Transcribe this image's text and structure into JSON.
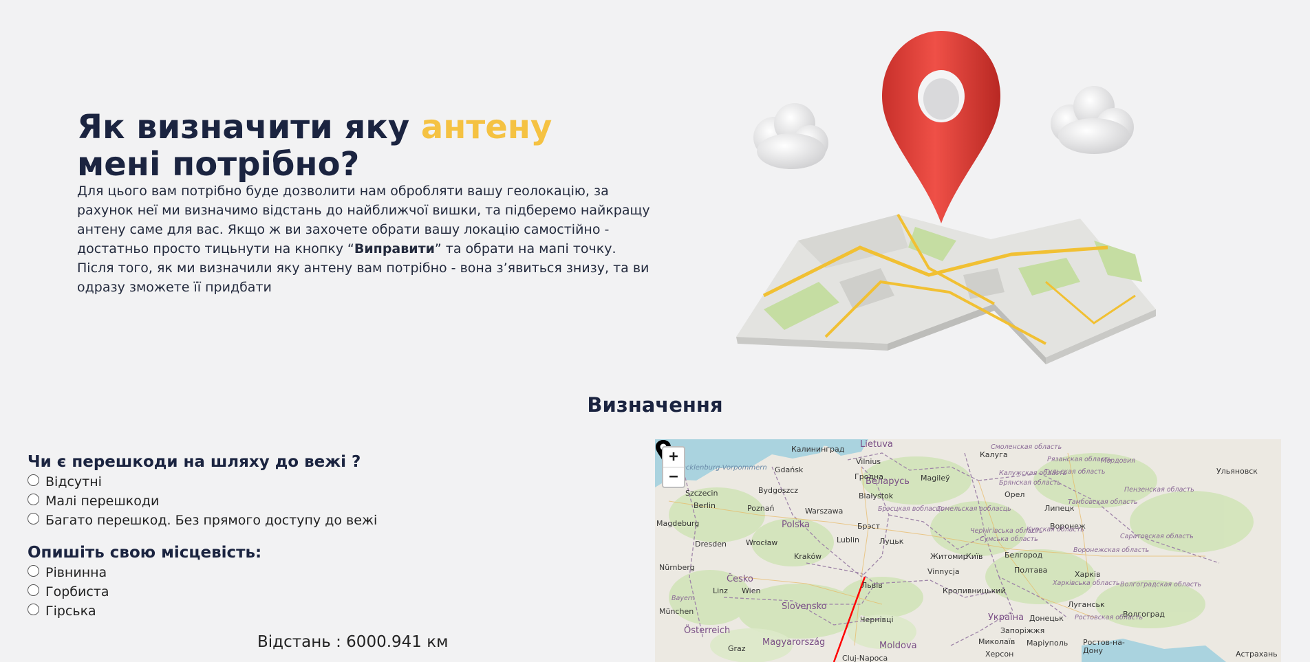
{
  "hero": {
    "title_before": "Як визначити яку ",
    "title_accent": "антену",
    "title_after": " мені потрібно?",
    "text_part1": "Для цього вам потрібно буде дозволити нам обробляти вашу геолокацію, за рахунок неї ми визначимо відстань до найближчої вишки, та підберемо найкращу антену саме для вас. Якщо ж ви захочете обрати вашу локацію самостійно - достатньо просто тицьнути на кнопку “",
    "text_bold": "Виправити",
    "text_part2": "” та обрати на мапі точку. Після того, як ми визначили яку антену вам потрібно - вона з’явиться знизу, та ви одразу зможете її придбати"
  },
  "section": {
    "title": "Визначення"
  },
  "obstacles": {
    "question": "Чи є перешкоди на шляху до вежі ?",
    "options": [
      "Відсутні",
      "Малі перешкоди",
      "Багато перешкод. Без прямого доступу до вежі"
    ]
  },
  "terrain": {
    "question": "Опишіть свою місцевість:",
    "options": [
      "Рівнинна",
      "Горбиста",
      "Гірська"
    ]
  },
  "distance": {
    "text": "Відстань : 6000.941 км"
  },
  "map": {
    "zoom_in": "+",
    "zoom_out": "−",
    "cities": [
      "Калининград",
      "Vilnius",
      "Калуга",
      "Ульяновск",
      "Gdańsk",
      "Гродна",
      "Magileў",
      "Szczecin",
      "Bydgoszcz",
      "Białystok",
      "Орел",
      "Berlin",
      "Poznań",
      "Warszawa",
      "Липецк",
      "Magdeburg",
      "Брэст",
      "Воронеж",
      "Dresden",
      "Wrocław",
      "Lublin",
      "Луцьк",
      "Житомир",
      "Київ",
      "Белгород",
      "Kraków",
      "Полтава",
      "Nürnberg",
      "Vinnycja",
      "Харків",
      "Linz",
      "Wien",
      "Кропивницький",
      "Луганськ",
      "München",
      "Graz",
      "Чернівці",
      "Донецьк",
      "Волгоград",
      "Запоріжжя",
      "Миколаїв",
      "Маріуполь",
      "Ростов-на-Дону",
      "Cluj-Napoca",
      "Херсон",
      "Астрахань",
      "Львів"
    ],
    "countries": [
      "Lietuva",
      "Беларусь",
      "Polska",
      "Česko",
      "Slovensko",
      "Україна",
      "Österreich",
      "Magyarország",
      "Moldova"
    ],
    "regions": [
      "Смоленская область",
      "Калужская область",
      "Рязанская область",
      "Мордовия",
      "Тульская область",
      "Брянская область",
      "Пензенская область",
      "Тамбовская область",
      "Гомельская вобласць",
      "Брэсцкая вобласць",
      "Курская область",
      "Чернігівська область",
      "Саратовская область",
      "Воронежская область",
      "Харківська область",
      "Волгоградская область",
      "Ростовская область",
      "Сумська область",
      "Bayern"
    ],
    "seas": [
      "Mecklenburg-Vorpommern"
    ]
  },
  "colors": {
    "accent": "#f5c242",
    "heading": "#1b2440",
    "pin": "#e0433a",
    "route": "#ff0000",
    "map_green": "#cfe3b4",
    "map_water": "#aad3df"
  }
}
